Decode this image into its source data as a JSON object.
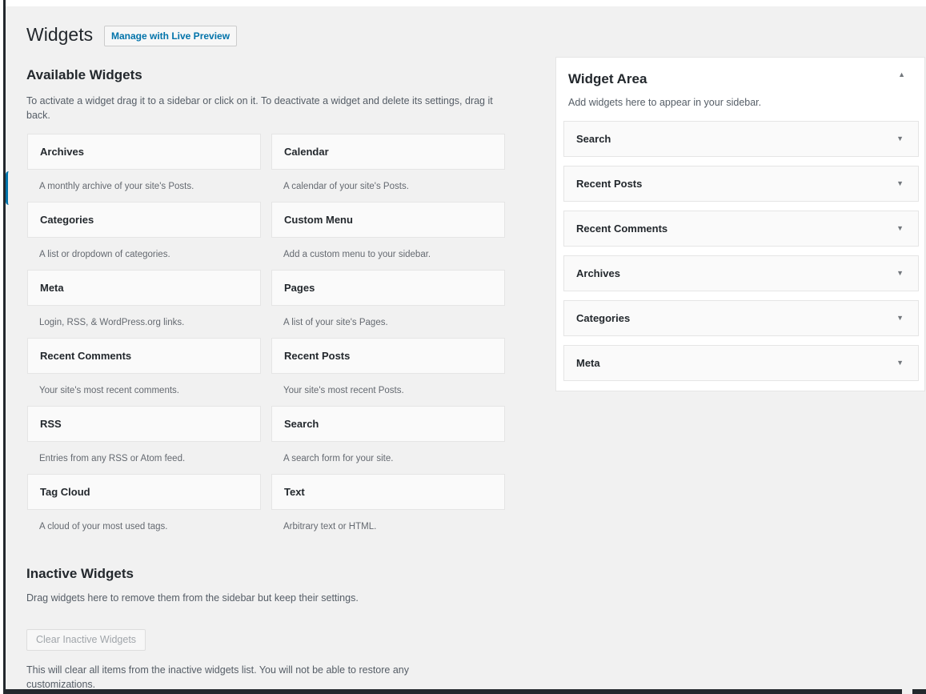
{
  "page": {
    "title": "Widgets",
    "live_preview_label": "Manage with Live Preview"
  },
  "available": {
    "heading": "Available Widgets",
    "description": "To activate a widget drag it to a sidebar or click on it. To deactivate a widget and delete its settings, drag it back.",
    "widgets": [
      {
        "name": "Archives",
        "desc": "A monthly archive of your site's Posts."
      },
      {
        "name": "Calendar",
        "desc": "A calendar of your site's Posts."
      },
      {
        "name": "Categories",
        "desc": "A list or dropdown of categories."
      },
      {
        "name": "Custom Menu",
        "desc": "Add a custom menu to your sidebar."
      },
      {
        "name": "Meta",
        "desc": "Login, RSS, & WordPress.org links."
      },
      {
        "name": "Pages",
        "desc": "A list of your site's Pages."
      },
      {
        "name": "Recent Comments",
        "desc": "Your site's most recent comments."
      },
      {
        "name": "Recent Posts",
        "desc": "Your site's most recent Posts."
      },
      {
        "name": "RSS",
        "desc": "Entries from any RSS or Atom feed."
      },
      {
        "name": "Search",
        "desc": "A search form for your site."
      },
      {
        "name": "Tag Cloud",
        "desc": "A cloud of your most used tags."
      },
      {
        "name": "Text",
        "desc": "Arbitrary text or HTML."
      }
    ]
  },
  "inactive": {
    "heading": "Inactive Widgets",
    "description": "Drag widgets here to remove them from the sidebar but keep their settings.",
    "clear_label": "Clear Inactive Widgets",
    "note": "This will clear all items from the inactive widgets list. You will not be able to restore any customizations."
  },
  "widget_area": {
    "title": "Widget Area",
    "description": "Add widgets here to appear in your sidebar.",
    "toggle_icon": "triangle-up-icon",
    "items": [
      "Search",
      "Recent Posts",
      "Recent Comments",
      "Archives",
      "Categories",
      "Meta"
    ]
  },
  "icons": {
    "collapse": "▲",
    "expand": "▼"
  },
  "colors": {
    "accent": "#0073aa",
    "background": "#f1f1f1"
  }
}
